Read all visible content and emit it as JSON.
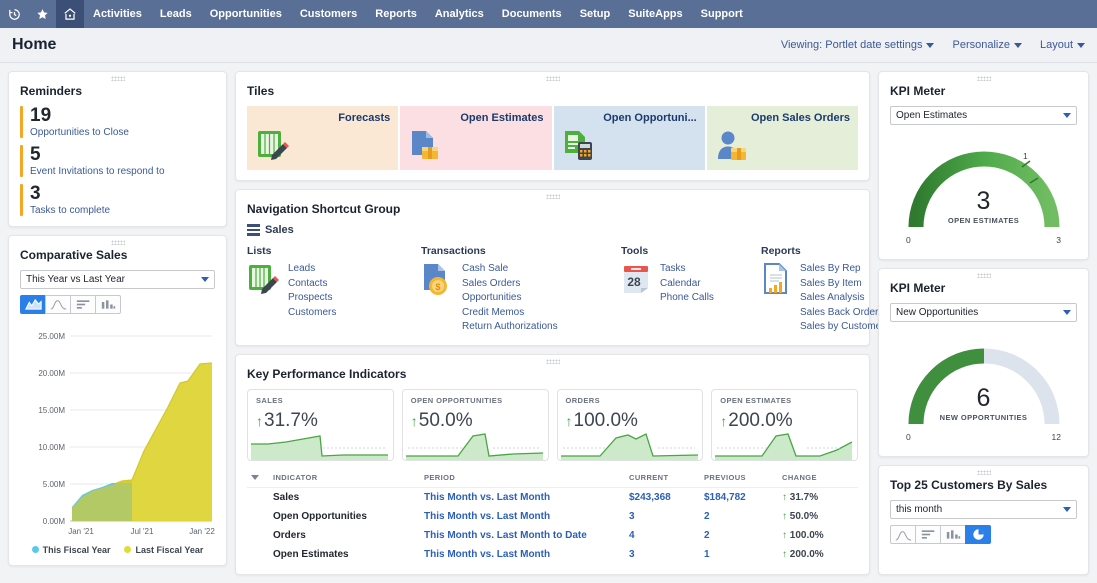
{
  "nav": {
    "icons": [
      {
        "name": "recent-history-icon",
        "glyph": "history"
      },
      {
        "name": "favorites-icon",
        "glyph": "star"
      },
      {
        "name": "home-icon",
        "glyph": "home"
      }
    ],
    "items": [
      {
        "label": "Activities"
      },
      {
        "label": "Leads"
      },
      {
        "label": "Opportunities"
      },
      {
        "label": "Customers"
      },
      {
        "label": "Reports"
      },
      {
        "label": "Analytics"
      },
      {
        "label": "Documents"
      },
      {
        "label": "Setup"
      },
      {
        "label": "SuiteApps"
      },
      {
        "label": "Support"
      }
    ]
  },
  "header": {
    "title": "Home",
    "actions": [
      {
        "label": "Viewing: Portlet date settings"
      },
      {
        "label": "Personalize"
      },
      {
        "label": "Layout"
      }
    ]
  },
  "reminders": {
    "title": "Reminders",
    "items": [
      {
        "count": "19",
        "label": "Opportunities to Close"
      },
      {
        "count": "5",
        "label": "Event Invitations to respond to"
      },
      {
        "count": "3",
        "label": "Tasks to complete"
      }
    ]
  },
  "comparative_sales": {
    "title": "Comparative Sales",
    "range_selected": "This Year vs Last Year",
    "chart_types": [
      {
        "name": "area-chart-icon",
        "selected": true
      },
      {
        "name": "line-chart-icon",
        "selected": false
      },
      {
        "name": "bar-chart-icon",
        "selected": false
      },
      {
        "name": "column-chart-icon",
        "selected": false
      }
    ]
  },
  "tiles": {
    "title": "Tiles",
    "items": [
      {
        "label": "Forecasts",
        "bg": "#fbe8d4",
        "icon": "forecast-ledger-icon"
      },
      {
        "label": "Open Estimates",
        "bg": "#fbdfe3",
        "icon": "estimate-document-icon"
      },
      {
        "label": "Open Opportuni...",
        "bg": "#d4e2f0",
        "icon": "opportunity-calculator-icon"
      },
      {
        "label": "Open Sales Orders",
        "bg": "#e4eed8",
        "icon": "sales-order-person-icon"
      }
    ]
  },
  "shortcuts": {
    "title": "Navigation Shortcut Group",
    "group_label": "Sales",
    "columns": [
      {
        "title": "Lists",
        "icon": "lists-ledger-icon",
        "links": [
          "Leads",
          "Contacts",
          "Prospects",
          "Customers"
        ]
      },
      {
        "title": "Transactions",
        "icon": "transactions-document-icon",
        "links": [
          "Cash Sale",
          "Sales Orders",
          "Opportunities",
          "Credit Memos",
          "Return Authorizations"
        ]
      },
      {
        "title": "Tools",
        "icon": "calendar-icon",
        "links": [
          "Tasks",
          "Calendar",
          "Phone Calls"
        ]
      },
      {
        "title": "Reports",
        "icon": "reports-document-icon",
        "links": [
          "Sales By Rep",
          "Sales By Item",
          "Sales Analysis",
          "Sales Back Orders",
          "Sales by Customer"
        ]
      }
    ]
  },
  "kpi": {
    "title": "Key Performance Indicators",
    "cards": [
      {
        "label": "SALES",
        "value": "31.7%",
        "direction": "up"
      },
      {
        "label": "OPEN OPPORTUNITIES",
        "value": "50.0%",
        "direction": "up"
      },
      {
        "label": "ORDERS",
        "value": "100.0%",
        "direction": "up"
      },
      {
        "label": "OPEN ESTIMATES",
        "value": "200.0%",
        "direction": "up"
      }
    ],
    "table": {
      "headers": [
        "INDICATOR",
        "PERIOD",
        "CURRENT",
        "PREVIOUS",
        "CHANGE"
      ],
      "rows": [
        {
          "indicator": "Sales",
          "period": "This Month vs. Last Month",
          "current": "$243,368",
          "previous": "$184,782",
          "change": "31.7%"
        },
        {
          "indicator": "Open Opportunities",
          "period": "This Month vs. Last Month",
          "current": "3",
          "previous": "2",
          "change": "50.0%"
        },
        {
          "indicator": "Orders",
          "period": "This Month vs. Last Month to Date",
          "current": "4",
          "previous": "2",
          "change": "100.0%"
        },
        {
          "indicator": "Open Estimates",
          "period": "This Month vs. Last Month",
          "current": "3",
          "previous": "1",
          "change": "200.0%"
        }
      ]
    }
  },
  "meters": [
    {
      "title": "KPI Meter",
      "selected": "Open Estimates",
      "value": "3",
      "caption": "OPEN ESTIMATES",
      "min": "0",
      "max": "3",
      "tick": "1",
      "fill_ratio": 1.0
    },
    {
      "title": "KPI Meter",
      "selected": "New Opportunities",
      "value": "6",
      "caption": "NEW OPPORTUNITIES",
      "min": "0",
      "max": "12",
      "tick": "",
      "fill_ratio": 0.5
    }
  ],
  "top_customers": {
    "title": "Top 25 Customers By Sales",
    "range_selected": "this month",
    "chart_types": [
      {
        "name": "line-chart-icon",
        "selected": false
      },
      {
        "name": "bar-chart-icon",
        "selected": false
      },
      {
        "name": "column-chart-icon",
        "selected": false
      },
      {
        "name": "pie-chart-icon",
        "selected": true
      }
    ]
  },
  "colors": {
    "nav_bg": "#5a6f96",
    "nav_home_bg": "#3c4f76",
    "link": "#3b5998",
    "accent_green": "#46a546",
    "gauge_green": "#3f8f3f",
    "gauge_track": "#dde3ec",
    "reminder_bar": "#f5a623",
    "this_fiscal_year": "#5bc8e8",
    "last_fiscal_year": "#e3d93a"
  },
  "chart_data": {
    "type": "area",
    "title": "Comparative Sales",
    "xlabel": "",
    "ylabel": "",
    "ylim": [
      0,
      25000000
    ],
    "ytick_labels": [
      "0.00M",
      "5.00M",
      "10.00M",
      "15.00M",
      "20.00M",
      "25.00M"
    ],
    "ytick_values": [
      0,
      5000000,
      10000000,
      15000000,
      20000000,
      25000000
    ],
    "xtick_labels": [
      "Jan '21",
      "Jul '21",
      "Jan '22"
    ],
    "grid": true,
    "legend_position": "bottom",
    "x": [
      "Jan '21",
      "Feb '21",
      "Mar '21",
      "Apr '21",
      "May '21",
      "Jun '21",
      "Jul '21",
      "Aug '21",
      "Sep '21",
      "Oct '21",
      "Nov '21",
      "Dec '21",
      "Jan '22"
    ],
    "series": [
      {
        "name": "This Fiscal Year",
        "color": "#5bc8e8",
        "values": [
          1900000,
          3500000,
          4200000,
          4600000,
          5150000,
          5150000,
          null,
          null,
          null,
          null,
          null,
          null,
          null
        ]
      },
      {
        "name": "Last Fiscal Year",
        "color": "#e3d93a",
        "values": [
          1800000,
          3200000,
          4000000,
          4500000,
          4900000,
          5400000,
          5500000,
          9500000,
          12500000,
          15500000,
          18700000,
          19000000,
          21200000
        ]
      }
    ]
  },
  "sparklines": {
    "sales": [
      14,
      14,
      14,
      14,
      13,
      12,
      11,
      10,
      9,
      9,
      8,
      6,
      26,
      26,
      25,
      25
    ],
    "open_opportunities": [
      26,
      26,
      26,
      26,
      26,
      26,
      26,
      18,
      6,
      4,
      12,
      26,
      26,
      24,
      23,
      23
    ],
    "orders": [
      26,
      26,
      26,
      26,
      26,
      22,
      12,
      6,
      9,
      7,
      5,
      5,
      26,
      26,
      25,
      25
    ],
    "open_estimates": [
      26,
      26,
      26,
      26,
      26,
      26,
      20,
      8,
      5,
      8,
      24,
      26,
      26,
      26,
      20,
      12
    ]
  }
}
